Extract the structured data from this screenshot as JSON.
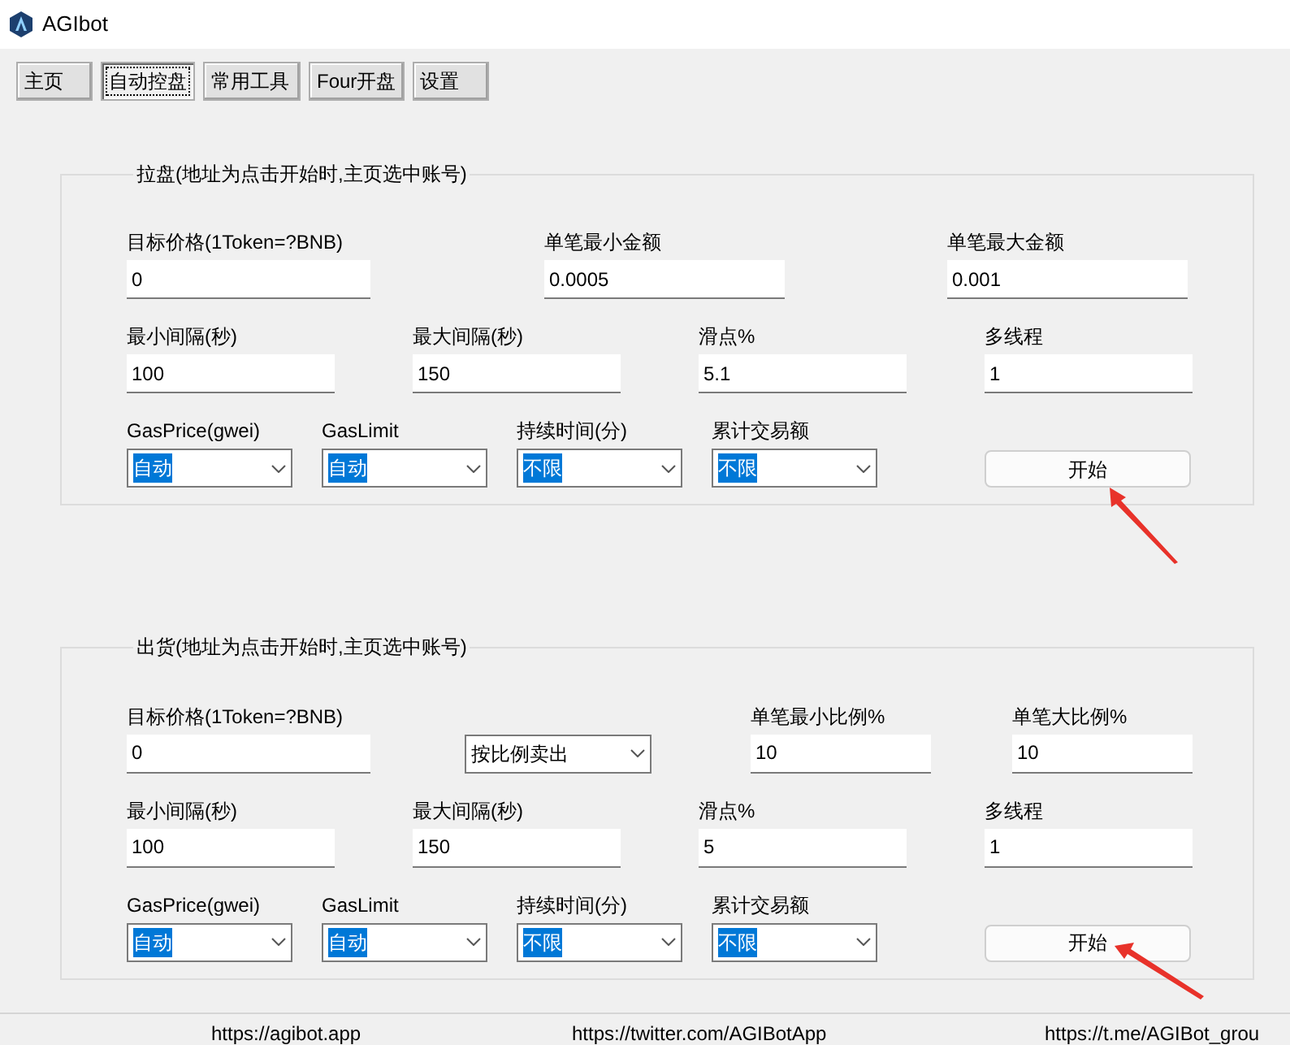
{
  "window": {
    "title": "AGIbot"
  },
  "tabs": [
    {
      "label": "主页",
      "selected": false
    },
    {
      "label": "自动控盘",
      "selected": true
    },
    {
      "label": "常用工具",
      "selected": false
    },
    {
      "label": "Four开盘",
      "selected": false
    },
    {
      "label": "设置",
      "selected": false
    }
  ],
  "sections": [
    {
      "legend": "拉盘(地址为点击开始时,主页选中账号)",
      "rows": [
        {
          "fields": [
            {
              "kind": "text",
              "label": "目标价格(1Token=?BNB)",
              "value": "0"
            },
            {
              "kind": "text",
              "label": "单笔最小金额",
              "value": "0.0005"
            },
            {
              "kind": "text",
              "label": "单笔最大金额",
              "value": "0.001"
            }
          ]
        },
        {
          "fields": [
            {
              "kind": "text",
              "label": "最小间隔(秒)",
              "value": "100"
            },
            {
              "kind": "text",
              "label": "最大间隔(秒)",
              "value": "150"
            },
            {
              "kind": "text",
              "label": "滑点%",
              "value": "5.1"
            },
            {
              "kind": "text",
              "label": "多线程",
              "value": "1"
            }
          ]
        },
        {
          "fields": [
            {
              "kind": "select",
              "label": "GasPrice(gwei)",
              "value": "自动",
              "highlighted": true
            },
            {
              "kind": "select",
              "label": "GasLimit",
              "value": "自动",
              "highlighted": true
            },
            {
              "kind": "select",
              "label": "持续时间(分)",
              "value": "不限",
              "highlighted": true
            },
            {
              "kind": "select",
              "label": "累计交易额",
              "value": "不限",
              "highlighted": true
            },
            {
              "kind": "button",
              "value": "开始"
            }
          ]
        }
      ]
    },
    {
      "legend": "出货(地址为点击开始时,主页选中账号)",
      "rows": [
        {
          "fields": [
            {
              "kind": "text",
              "label": "目标价格(1Token=?BNB)",
              "value": "0"
            },
            {
              "kind": "select",
              "value": "按比例卖出",
              "highlighted": false
            },
            {
              "kind": "text",
              "label": "单笔最小比例%",
              "value": "10"
            },
            {
              "kind": "text",
              "label": "单笔大比例%",
              "value": "10"
            }
          ]
        },
        {
          "fields": [
            {
              "kind": "text",
              "label": "最小间隔(秒)",
              "value": "100"
            },
            {
              "kind": "text",
              "label": "最大间隔(秒)",
              "value": "150"
            },
            {
              "kind": "text",
              "label": "滑点%",
              "value": "5"
            },
            {
              "kind": "text",
              "label": "多线程",
              "value": "1"
            }
          ]
        },
        {
          "fields": [
            {
              "kind": "select",
              "label": "GasPrice(gwei)",
              "value": "自动",
              "highlighted": true
            },
            {
              "kind": "select",
              "label": "GasLimit",
              "value": "自动",
              "highlighted": true
            },
            {
              "kind": "select",
              "label": "持续时间(分)",
              "value": "不限",
              "highlighted": true
            },
            {
              "kind": "select",
              "label": "累计交易额",
              "value": "不限",
              "highlighted": true
            },
            {
              "kind": "button",
              "value": "开始"
            }
          ]
        }
      ]
    }
  ],
  "status_bar": [
    "https://agibot.app",
    "https://twitter.com/AGIBotApp",
    "https://t.me/AGIBot_grou"
  ]
}
